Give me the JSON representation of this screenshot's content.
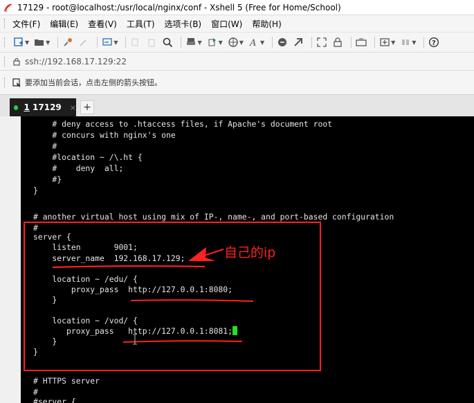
{
  "window": {
    "title": "17129 - root@localhost:/usr/local/nginx/conf - Xshell 5 (Free for Home/School)"
  },
  "menu": [
    "文件(F)",
    "编辑(E)",
    "查看(V)",
    "工具(T)",
    "选项卡(B)",
    "窗口(W)",
    "帮助(H)"
  ],
  "address": {
    "value": "ssh://192.168.17.129:22"
  },
  "hint": {
    "text": "要添加当前会话，点击左侧的箭头按钮。"
  },
  "tab": {
    "index": "1",
    "name": "17129",
    "close": "×",
    "add": "+"
  },
  "terminal_lines": [
    "    # deny access to .htaccess files, if Apache's document root",
    "    # concurs with nginx's one",
    "    #",
    "    #location ~ /\\.ht {",
    "    #    deny  all;",
    "    #}",
    "}",
    "",
    "",
    "# another virtual host using mix of IP-, name-, and port-based configuration",
    "#",
    "server {",
    "    listen       9001;",
    "    server_name  192.168.17.129;",
    "",
    "    location ~ /edu/ {",
    "        proxy_pass  http://127.0.0.1:8080;",
    "    }",
    "",
    "    location ~ /vod/ {",
    "       proxy_pass   http://127.0.0.1:8081;",
    "    }",
    "}",
    "",
    "",
    "# HTTPS server",
    "#",
    "#server {"
  ],
  "annotation": {
    "text": "自己的ip",
    "color": "#ff2020"
  },
  "colors": {
    "terminal_bg": "#000000",
    "terminal_fg": "#e6e6e6",
    "cursor": "#22e022",
    "annotation": "#ff2020"
  }
}
